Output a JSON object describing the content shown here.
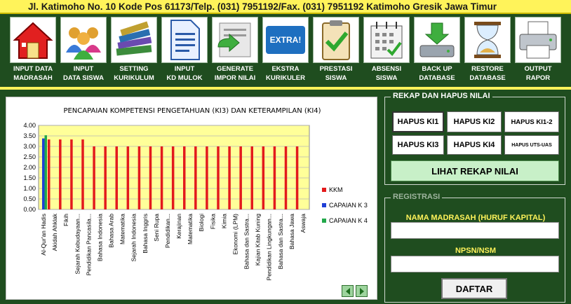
{
  "header": {
    "address": "Jl. Katimoho No. 10  Kode Pos 61173/Telp. (031) 7951192/Fax. (031) 7951192  Katimoho  Gresik  Jawa Timur"
  },
  "toolbar": {
    "items": [
      {
        "line1": "INPUT DATA",
        "line2": "MADRASAH",
        "icon": "house-icon"
      },
      {
        "line1": "INPUT",
        "line2": "DATA SISWA",
        "icon": "people-icon"
      },
      {
        "line1": "SETTING",
        "line2": "KURIKULUM",
        "icon": "books-icon"
      },
      {
        "line1": "INPUT",
        "line2": "KD MULOK",
        "icon": "document-icon"
      },
      {
        "line1": "GENERATE",
        "line2": "IMPOR NILAI",
        "icon": "import-icon"
      },
      {
        "line1": "EKSTRA",
        "line2": "KURIKULER",
        "icon": "extra-icon",
        "badge": "EXTRA!"
      },
      {
        "line1": "PRESTASI",
        "line2": "SISWA",
        "icon": "clipboard-check-icon"
      },
      {
        "line1": "ABSENSI",
        "line2": "SISWA",
        "icon": "calendar-icon"
      },
      {
        "line1": "BACK UP",
        "line2": "DATABASE",
        "icon": "backup-drive-icon"
      },
      {
        "line1": "RESTORE",
        "line2": "DATABASE",
        "icon": "hourglass-icon"
      },
      {
        "line1": "OUTPUT",
        "line2": "RAPOR",
        "icon": "printer-icon"
      }
    ]
  },
  "chart_data": {
    "type": "bar",
    "title": "PENCAPAIAN KOMPETENSI PENGETAHUAN (KI3) DAN KETERAMPILAN (KI4)",
    "categories": [
      "Al-Qur'an Hadis",
      "Akidah Ahklak",
      "Fikih",
      "Sejarah Kebudayaan...",
      "Pendidikan Pancasila...",
      "Bahasa Indonesia",
      "Bahasa Arab",
      "Matematika",
      "Sejarah Indonesia",
      "Bahasa Inggris",
      "Seni Rupa",
      "Pendidikan...",
      "Kerajinan",
      "Matematika",
      "Biologi",
      "Fisika",
      "Kimia",
      "Ekonomi (LPM)",
      "Bahasa dan Sastra...",
      "Kajian Kitab Kuning",
      "Pendidikan Lingkungan...",
      "Bahasa dan Sastra...",
      "Bahasa Jawa",
      "Aswaja"
    ],
    "series": [
      {
        "name": "KKM",
        "color": "#e31a1c",
        "values": [
          3.33,
          3.33,
          3.33,
          3.33,
          3.0,
          3.0,
          3.0,
          3.0,
          3.0,
          3.0,
          3.0,
          3.0,
          3.0,
          3.0,
          3.0,
          3.0,
          3.0,
          3.0,
          3.0,
          3.0,
          3.0,
          3.0,
          3.0,
          0
        ]
      },
      {
        "name": "CAPAIAN  K 3",
        "color": "#1f3fd6",
        "values": [
          3.38,
          0,
          0,
          0,
          0,
          0,
          0,
          0,
          0,
          0,
          0,
          0,
          0,
          0,
          0,
          0,
          0,
          0,
          0,
          0,
          0,
          0,
          0,
          0
        ]
      },
      {
        "name": "CAPAIAN  K 4",
        "color": "#22a84a",
        "values": [
          3.53,
          0,
          0,
          0,
          0,
          0,
          0,
          0,
          0,
          0,
          0,
          0,
          0,
          0,
          0,
          0,
          0,
          0,
          0,
          0,
          0,
          0,
          0,
          0
        ]
      }
    ],
    "yticks": [
      "4.00",
      "3.50",
      "3.00",
      "2.50",
      "2.00",
      "1.50",
      "1.00",
      "0.50",
      "0.00"
    ],
    "ylim": [
      0,
      4
    ],
    "plot_bg": "#ffff99",
    "grid": true,
    "legend_position": "right"
  },
  "rekap": {
    "legend": "REKAP DAN HAPUS NILAI",
    "b1": "HAPUS KI1",
    "b2": "HAPUS KI2",
    "b3": "HAPUS KI1-2",
    "b4": "HAPUS KI3",
    "b5": "HAPUS KI4",
    "b6": "HAPUS UTS-UAS",
    "lihat": "LIHAT REKAP NILAI"
  },
  "registrasi": {
    "legend": "REGISTRASI",
    "label_nama": "NAMA MADRASAH (HURUF KAPITAL)",
    "label_npsn": "NPSN/NSM",
    "nama_value": "",
    "npsn_value": "",
    "daftar": "DAFTAR"
  }
}
